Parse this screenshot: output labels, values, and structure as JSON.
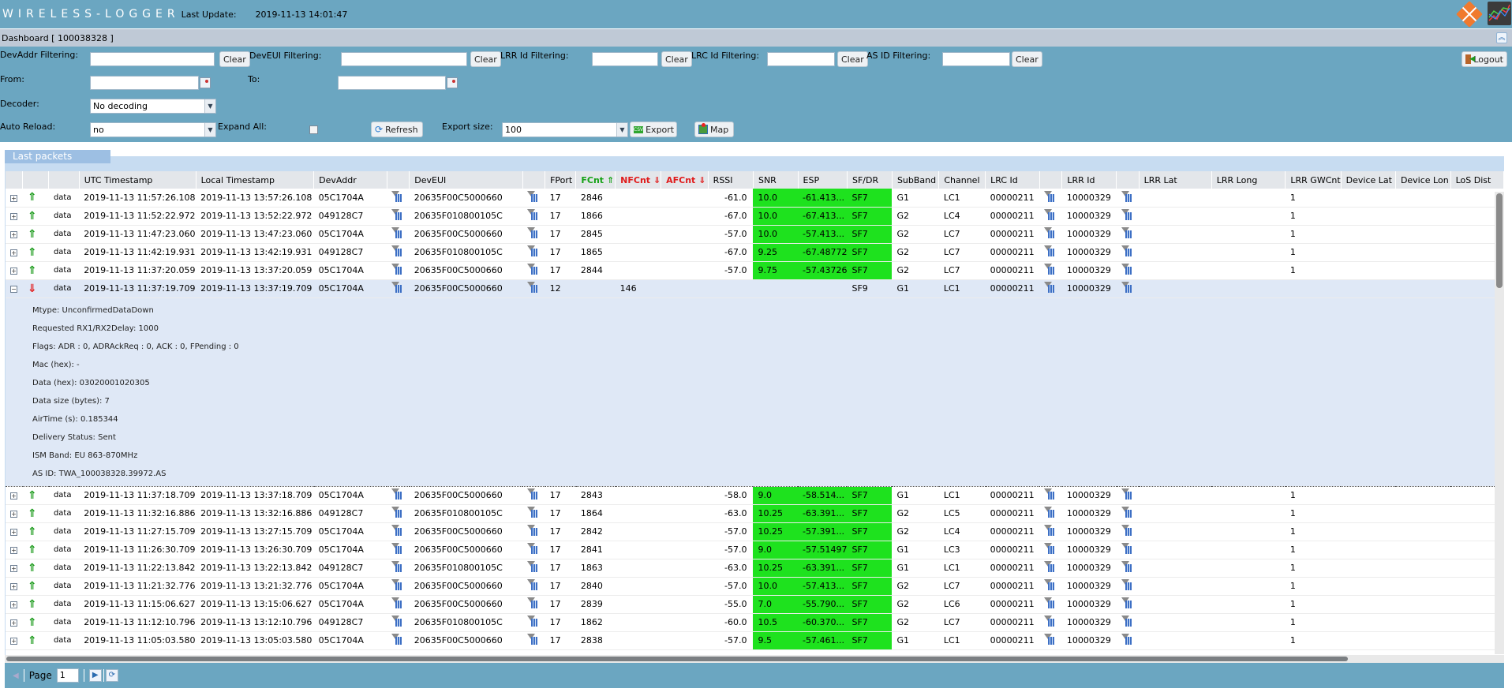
{
  "app": {
    "brand": "WIRELESS-LOGGER",
    "last_update_label": "Last Update:",
    "last_update_value": "2019-11-13 14:01:47"
  },
  "dashboard": {
    "title": "Dashboard [ 100038328 ]",
    "collapse_icon": "double-chevron-up-icon"
  },
  "filters": {
    "devaddr": {
      "label": "DevAddr Filtering:",
      "value": "",
      "clear": "Clear"
    },
    "deveui": {
      "label": "DevEUI Filtering:",
      "value": "",
      "clear": "Clear"
    },
    "lrr": {
      "label": "LRR Id Filtering:",
      "value": "",
      "clear": "Clear"
    },
    "lrc": {
      "label": "LRC Id Filtering:",
      "value": "",
      "clear": "Clear"
    },
    "asid": {
      "label": "AS ID Filtering:",
      "value": "",
      "clear": "Clear"
    },
    "from": {
      "label": "From:",
      "value": ""
    },
    "to": {
      "label": "To:",
      "value": ""
    },
    "decoder": {
      "label": "Decoder:",
      "value": "No decoding"
    },
    "auto_reload": {
      "label": "Auto Reload:",
      "value": "no"
    },
    "expand_all": {
      "label": "Expand All:",
      "checked": false
    },
    "refresh": "Refresh",
    "export_size": {
      "label": "Export size:",
      "value": "100"
    },
    "export": "Export",
    "map": "Map",
    "logout": "Logout"
  },
  "panel": {
    "title": "Last packets"
  },
  "columns": [
    "",
    "",
    "",
    "UTC Timestamp",
    "Local Timestamp",
    "DevAddr",
    "",
    "DevEUI",
    "",
    "FPort",
    "FCnt ⇑",
    "NFCnt ⇓",
    "AFCnt ⇓",
    "RSSI",
    "SNR",
    "ESP",
    "SF/DR",
    "SubBand",
    "Channel",
    "LRC Id",
    "",
    "LRR Id",
    "",
    "LRR Lat",
    "LRR Long",
    "LRR GWCnt",
    "Device Lat",
    "Device Lon",
    "LoS Dist"
  ],
  "rows_top": [
    {
      "dir": "up",
      "type": "data",
      "utc": "2019-11-13 11:57:26.108",
      "local": "2019-11-13 13:57:26.108",
      "devaddr": "05C1704A",
      "deveui": "20635F00C5000660",
      "fport": "17",
      "fcnt": "2846",
      "nfcnt": "",
      "afcnt": "",
      "rssi": "-61.0",
      "snr": "10.0",
      "esp": "-61.413...",
      "sf": "SF7",
      "subband": "G1",
      "channel": "LC1",
      "lrc": "00000211",
      "lrr": "10000329",
      "gwcnt": "1"
    },
    {
      "dir": "up",
      "type": "data",
      "utc": "2019-11-13 11:52:22.972",
      "local": "2019-11-13 13:52:22.972",
      "devaddr": "049128C7",
      "deveui": "20635F010800105C",
      "fport": "17",
      "fcnt": "1866",
      "nfcnt": "",
      "afcnt": "",
      "rssi": "-67.0",
      "snr": "10.0",
      "esp": "-67.413...",
      "sf": "SF7",
      "subband": "G2",
      "channel": "LC4",
      "lrc": "00000211",
      "lrr": "10000329",
      "gwcnt": "1"
    },
    {
      "dir": "up",
      "type": "data",
      "utc": "2019-11-13 11:47:23.060",
      "local": "2019-11-13 13:47:23.060",
      "devaddr": "05C1704A",
      "deveui": "20635F00C5000660",
      "fport": "17",
      "fcnt": "2845",
      "nfcnt": "",
      "afcnt": "",
      "rssi": "-57.0",
      "snr": "10.0",
      "esp": "-57.413...",
      "sf": "SF7",
      "subband": "G2",
      "channel": "LC7",
      "lrc": "00000211",
      "lrr": "10000329",
      "gwcnt": "1"
    },
    {
      "dir": "up",
      "type": "data",
      "utc": "2019-11-13 11:42:19.931",
      "local": "2019-11-13 13:42:19.931",
      "devaddr": "049128C7",
      "deveui": "20635F010800105C",
      "fport": "17",
      "fcnt": "1865",
      "nfcnt": "",
      "afcnt": "",
      "rssi": "-67.0",
      "snr": "9.25",
      "esp": "-67.48772",
      "sf": "SF7",
      "subband": "G2",
      "channel": "LC7",
      "lrc": "00000211",
      "lrr": "10000329",
      "gwcnt": "1"
    },
    {
      "dir": "up",
      "type": "data",
      "utc": "2019-11-13 11:37:20.059",
      "local": "2019-11-13 13:37:20.059",
      "devaddr": "05C1704A",
      "deveui": "20635F00C5000660",
      "fport": "17",
      "fcnt": "2844",
      "nfcnt": "",
      "afcnt": "",
      "rssi": "-57.0",
      "snr": "9.75",
      "esp": "-57.43726",
      "sf": "SF7",
      "subband": "G2",
      "channel": "LC7",
      "lrc": "00000211",
      "lrr": "10000329",
      "gwcnt": "1"
    }
  ],
  "expanded_row": {
    "dir": "down",
    "type": "data",
    "utc": "2019-11-13 11:37:19.709",
    "local": "2019-11-13 13:37:19.709",
    "devaddr": "05C1704A",
    "deveui": "20635F00C5000660",
    "fport": "12",
    "fcnt": "",
    "nfcnt": "146",
    "afcnt": "",
    "rssi": "",
    "snr": "",
    "esp": "",
    "sf": "SF9",
    "subband": "G1",
    "channel": "LC1",
    "lrc": "00000211",
    "lrr": "10000329",
    "gwcnt": "",
    "details": [
      "Mtype: UnconfirmedDataDown",
      "Requested RX1/RX2Delay: 1000",
      "Flags: ADR : 0, ADRAckReq : 0, ACK : 0, FPending : 0",
      "Mac (hex): -",
      "Data (hex): 03020001020305",
      "Data size (bytes): 7",
      "AirTime (s): 0.185344",
      "Delivery Status: Sent",
      "ISM Band: EU 863-870MHz",
      "AS ID: TWA_100038328.39972.AS"
    ]
  },
  "rows_bottom": [
    {
      "dir": "up",
      "type": "data",
      "utc": "2019-11-13 11:37:18.709",
      "local": "2019-11-13 13:37:18.709",
      "devaddr": "05C1704A",
      "deveui": "20635F00C5000660",
      "fport": "17",
      "fcnt": "2843",
      "nfcnt": "",
      "afcnt": "",
      "rssi": "-58.0",
      "snr": "9.0",
      "esp": "-58.514...",
      "sf": "SF7",
      "subband": "G1",
      "channel": "LC1",
      "lrc": "00000211",
      "lrr": "10000329",
      "gwcnt": "1"
    },
    {
      "dir": "up",
      "type": "data",
      "utc": "2019-11-13 11:32:16.886",
      "local": "2019-11-13 13:32:16.886",
      "devaddr": "049128C7",
      "deveui": "20635F010800105C",
      "fport": "17",
      "fcnt": "1864",
      "nfcnt": "",
      "afcnt": "",
      "rssi": "-63.0",
      "snr": "10.25",
      "esp": "-63.391...",
      "sf": "SF7",
      "subband": "G2",
      "channel": "LC5",
      "lrc": "00000211",
      "lrr": "10000329",
      "gwcnt": "1"
    },
    {
      "dir": "up",
      "type": "data",
      "utc": "2019-11-13 11:27:15.709",
      "local": "2019-11-13 13:27:15.709",
      "devaddr": "05C1704A",
      "deveui": "20635F00C5000660",
      "fport": "17",
      "fcnt": "2842",
      "nfcnt": "",
      "afcnt": "",
      "rssi": "-57.0",
      "snr": "10.25",
      "esp": "-57.391...",
      "sf": "SF7",
      "subband": "G2",
      "channel": "LC4",
      "lrc": "00000211",
      "lrr": "10000329",
      "gwcnt": "1"
    },
    {
      "dir": "up",
      "type": "data",
      "utc": "2019-11-13 11:26:30.709",
      "local": "2019-11-13 13:26:30.709",
      "devaddr": "05C1704A",
      "deveui": "20635F00C5000660",
      "fport": "17",
      "fcnt": "2841",
      "nfcnt": "",
      "afcnt": "",
      "rssi": "-57.0",
      "snr": "9.0",
      "esp": "-57.51497",
      "sf": "SF7",
      "subband": "G1",
      "channel": "LC3",
      "lrc": "00000211",
      "lrr": "10000329",
      "gwcnt": "1"
    },
    {
      "dir": "up",
      "type": "data",
      "utc": "2019-11-13 11:22:13.842",
      "local": "2019-11-13 13:22:13.842",
      "devaddr": "049128C7",
      "deveui": "20635F010800105C",
      "fport": "17",
      "fcnt": "1863",
      "nfcnt": "",
      "afcnt": "",
      "rssi": "-63.0",
      "snr": "10.25",
      "esp": "-63.391...",
      "sf": "SF7",
      "subband": "G1",
      "channel": "LC1",
      "lrc": "00000211",
      "lrr": "10000329",
      "gwcnt": "1"
    },
    {
      "dir": "up",
      "type": "data",
      "utc": "2019-11-13 11:21:32.776",
      "local": "2019-11-13 13:21:32.776",
      "devaddr": "05C1704A",
      "deveui": "20635F00C5000660",
      "fport": "17",
      "fcnt": "2840",
      "nfcnt": "",
      "afcnt": "",
      "rssi": "-57.0",
      "snr": "10.0",
      "esp": "-57.413...",
      "sf": "SF7",
      "subband": "G2",
      "channel": "LC7",
      "lrc": "00000211",
      "lrr": "10000329",
      "gwcnt": "1"
    },
    {
      "dir": "up",
      "type": "data",
      "utc": "2019-11-13 11:15:06.627",
      "local": "2019-11-13 13:15:06.627",
      "devaddr": "05C1704A",
      "deveui": "20635F00C5000660",
      "fport": "17",
      "fcnt": "2839",
      "nfcnt": "",
      "afcnt": "",
      "rssi": "-55.0",
      "snr": "7.0",
      "esp": "-55.790...",
      "sf": "SF7",
      "subband": "G2",
      "channel": "LC6",
      "lrc": "00000211",
      "lrr": "10000329",
      "gwcnt": "1"
    },
    {
      "dir": "up",
      "type": "data",
      "utc": "2019-11-13 11:12:10.796",
      "local": "2019-11-13 13:12:10.796",
      "devaddr": "049128C7",
      "deveui": "20635F010800105C",
      "fport": "17",
      "fcnt": "1862",
      "nfcnt": "",
      "afcnt": "",
      "rssi": "-60.0",
      "snr": "10.5",
      "esp": "-60.370...",
      "sf": "SF7",
      "subband": "G2",
      "channel": "LC7",
      "lrc": "00000211",
      "lrr": "10000329",
      "gwcnt": "1"
    },
    {
      "dir": "up",
      "type": "data",
      "utc": "2019-11-13 11:05:03.580",
      "local": "2019-11-13 13:05:03.580",
      "devaddr": "05C1704A",
      "deveui": "20635F00C5000660",
      "fport": "17",
      "fcnt": "2838",
      "nfcnt": "",
      "afcnt": "",
      "rssi": "-57.0",
      "snr": "9.5",
      "esp": "-57.461...",
      "sf": "SF7",
      "subband": "G1",
      "channel": "LC1",
      "lrc": "00000211",
      "lrr": "10000329",
      "gwcnt": "1"
    }
  ],
  "pager": {
    "label": "Page",
    "value": "1"
  },
  "colors": {
    "header_bg": "#6ba6c1",
    "good_signal": "#1ee21e",
    "uplink": "#1a9a1a",
    "downlink": "#e21b1b",
    "selected_row": "#dfe8f6"
  }
}
